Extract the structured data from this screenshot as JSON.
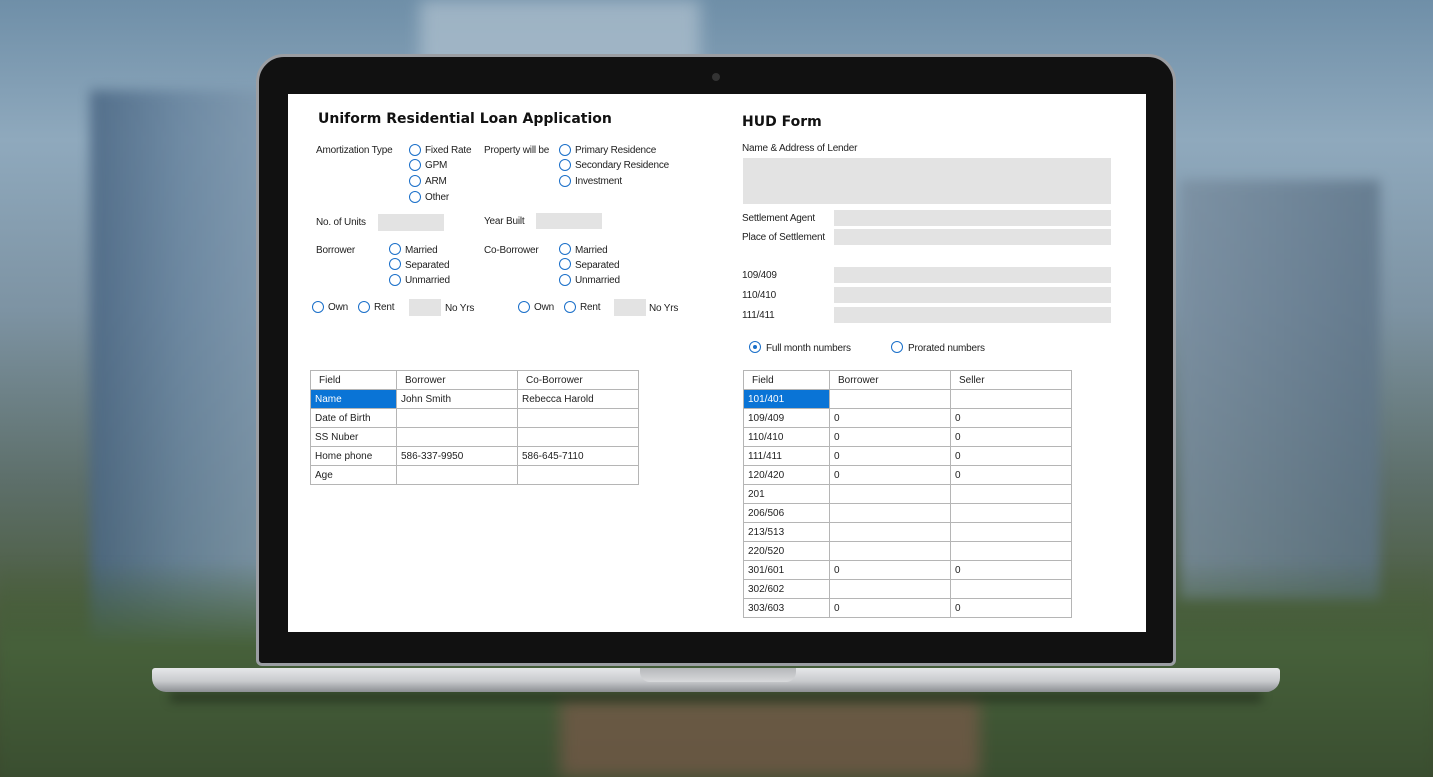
{
  "loan": {
    "title": "Uniform Residential Loan Application",
    "amortization_label": "Amortization Type",
    "amortization_options": [
      "Fixed Rate",
      "GPM",
      "ARM",
      "Other"
    ],
    "property_label": "Property will be",
    "property_options": [
      "Primary Residence",
      "Secondary Residence",
      "Investment"
    ],
    "units_label": "No. of Units",
    "year_built_label": "Year Built",
    "borrower_label": "Borrower",
    "coborrower_label": "Co-Borrower",
    "marital_options": [
      "Married",
      "Separated",
      "Unmarried"
    ],
    "own_label": "Own",
    "rent_label": "Rent",
    "no_yrs_label": "No Yrs",
    "table": {
      "headers": [
        "Field",
        "Borrower",
        "Co-Borrower"
      ],
      "rows": [
        [
          "Name",
          "John Smith",
          "Rebecca Harold"
        ],
        [
          "Date of Birth",
          "",
          ""
        ],
        [
          "SS Nuber",
          "",
          ""
        ],
        [
          "Home phone",
          "586-337-9950",
          "586-645-7110"
        ],
        [
          "Age",
          "",
          ""
        ]
      ]
    }
  },
  "hud": {
    "title": "HUD Form",
    "lender_label": "Name & Address of Lender",
    "agent_label": "Settlement Agent",
    "place_label": "Place of Settlement",
    "line_labels": [
      "109/409",
      "110/410",
      "111/411"
    ],
    "full_month_label": "Full month numbers",
    "prorated_label": "Prorated numbers",
    "full_month_selected": true,
    "table": {
      "headers": [
        "Field",
        "Borrower",
        "Seller"
      ],
      "rows": [
        [
          "101/401",
          "",
          ""
        ],
        [
          "109/409",
          "0",
          "0"
        ],
        [
          "110/410",
          "0",
          "0"
        ],
        [
          "111/411",
          "0",
          "0"
        ],
        [
          "120/420",
          "0",
          "0"
        ],
        [
          "201",
          "",
          ""
        ],
        [
          "206/506",
          "",
          ""
        ],
        [
          "213/513",
          "",
          ""
        ],
        [
          "220/520",
          "",
          ""
        ],
        [
          "301/601",
          "0",
          "0"
        ],
        [
          "302/602",
          "",
          ""
        ],
        [
          "303/603",
          "0",
          "0"
        ]
      ]
    }
  },
  "colors": {
    "accent": "#1a6fc9",
    "selection": "#0a74d6",
    "field_bg": "#e3e3e3"
  }
}
